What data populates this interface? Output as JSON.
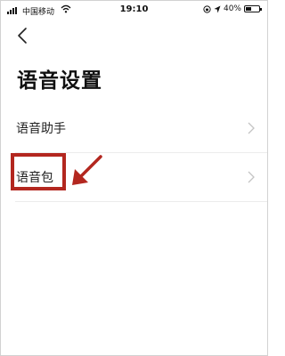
{
  "status_bar": {
    "carrier": "中国移动",
    "time": "19:10",
    "battery": "40%",
    "battery_level": 0.4,
    "icons": [
      "signal-icon",
      "wifi-icon",
      "orientation-lock-icon",
      "location-icon",
      "battery-icon"
    ]
  },
  "nav": {
    "back_icon": "chevron-left-icon"
  },
  "page": {
    "title": "语音设置"
  },
  "list": {
    "items": [
      {
        "label": "语音助手",
        "icon": "chevron-right-icon"
      },
      {
        "label": "语音包",
        "icon": "chevron-right-icon"
      }
    ]
  },
  "annotation": {
    "highlight_color": "#b3271f",
    "arrow_color": "#b3271f"
  }
}
